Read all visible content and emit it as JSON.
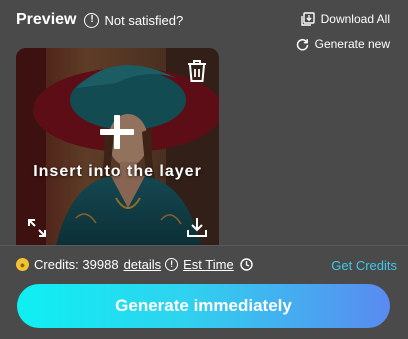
{
  "header": {
    "title": "Preview",
    "not_satisfied_label": "Not satisfied?",
    "download_all_label": "Download All",
    "generate_new_label": "Generate new"
  },
  "preview": {
    "insert_label": "Insert into the layer"
  },
  "credits": {
    "label": "Credits: 39988",
    "details_link": "details",
    "est_time_link": "Est Time",
    "get_credits_label": "Get Credits"
  },
  "generate_button": {
    "label": "Generate immediately"
  },
  "colors": {
    "background": "#4a4a4a",
    "accent_link": "#3ec8ea",
    "button_gradient_start": "#0ef0f2",
    "button_gradient_end": "#5a8af0",
    "coin": "#f2c230"
  },
  "icons": {
    "not_satisfied": "info-circle-icon",
    "download_all": "download-all-icon",
    "generate_new": "refresh-icon",
    "delete": "trash-icon",
    "insert": "plus-icon",
    "expand": "expand-icon",
    "download": "download-icon",
    "coin": "coin-icon",
    "details_info": "info-circle-icon",
    "est_time": "clock-icon"
  }
}
